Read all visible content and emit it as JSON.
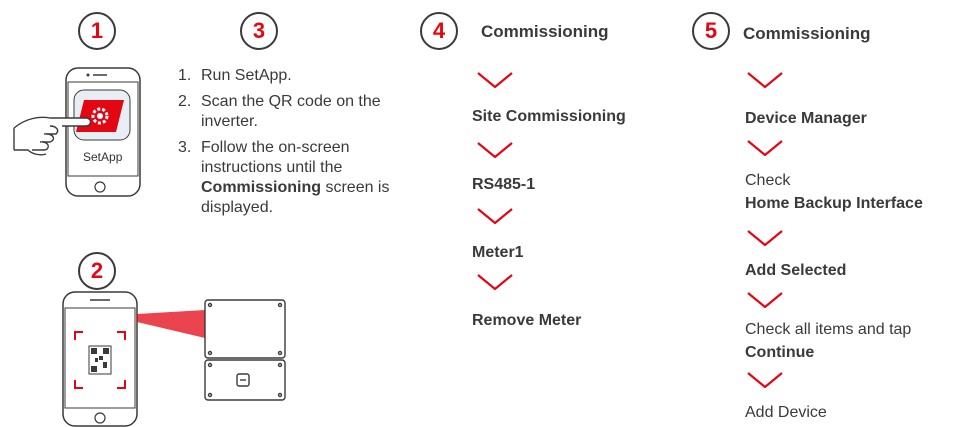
{
  "badges": {
    "b1": "1",
    "b2": "2",
    "b3": "3",
    "b4": "4",
    "b5": "5"
  },
  "app": {
    "label": "SetApp"
  },
  "instructions": {
    "item1": {
      "num": "1.",
      "text": "Run SetApp."
    },
    "item2": {
      "num": "2.",
      "text": "Scan the QR code on the inverter."
    },
    "item3": {
      "num": "3.",
      "pre": "Follow the on-screen instructions until the ",
      "bold": "Commissioning",
      "post": " screen is displayed."
    }
  },
  "flow4": {
    "heading": "Commissioning",
    "steps": [
      "Site Commissioning",
      "RS485-1",
      "Meter1",
      "Remove Meter"
    ]
  },
  "flow5": {
    "heading": "Commissioning",
    "step1": "Device Manager",
    "step2_pre": "Check",
    "step2_bold": "Home Backup Interface",
    "step3": "Add Selected",
    "step4_pre": "Check all items and tap",
    "step4_bold": "Continue",
    "step5": "Add Device"
  },
  "colors": {
    "accent": "#e30613",
    "text": "#3a3a3a"
  },
  "icons": [
    "hand-pointer-icon",
    "gear-icon",
    "qr-code-icon",
    "inverter-icon",
    "chevron-down-icon"
  ]
}
